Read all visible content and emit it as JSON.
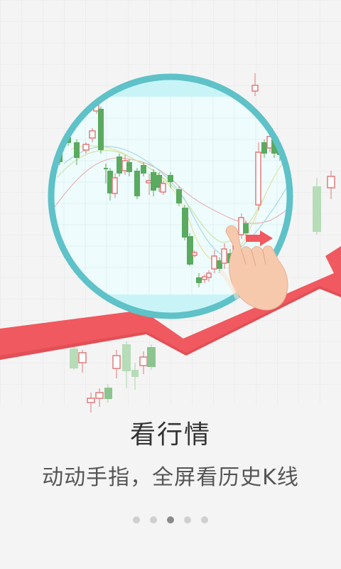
{
  "onboarding": {
    "title": "看行情",
    "subtitle": "动动手指，全屏看历史K线",
    "page_indicator": {
      "total": 5,
      "current": 3
    }
  },
  "colors": {
    "background": "#f4f4f4",
    "arrow": "#f0595f",
    "magnifier_ring": "#5ec2c8",
    "magnifier_fill": "#eefcfd",
    "candle_up": "#5aaa5f",
    "candle_down": "#e07a7a",
    "hand": "#f6c9ad"
  }
}
